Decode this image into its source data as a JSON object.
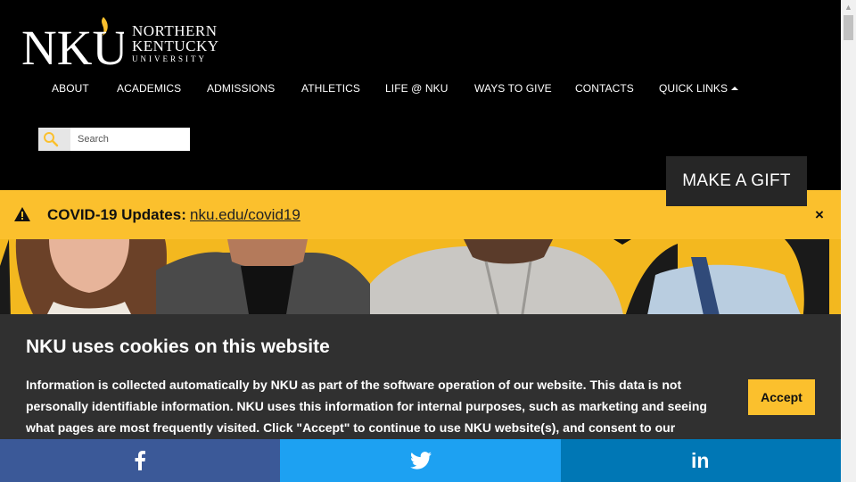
{
  "logo": {
    "mark": "NKU",
    "line1": "NORTHERN",
    "line2": "KENTUCKY",
    "line3": "UNIVERSITY",
    "flame_color": "#fbc02d"
  },
  "nav": {
    "items": [
      {
        "label": "ABOUT"
      },
      {
        "label": "ACADEMICS"
      },
      {
        "label": "ADMISSIONS"
      },
      {
        "label": "ATHLETICS"
      },
      {
        "label": "LIFE @ NKU"
      },
      {
        "label": "WAYS TO GIVE"
      },
      {
        "label": "CONTACTS"
      },
      {
        "label": "QUICK LINKS"
      }
    ]
  },
  "search": {
    "placeholder": "Search",
    "icon": "search-icon"
  },
  "gift_button": "MAKE A GIFT",
  "covid": {
    "label": "COVID-19 Updates:",
    "link": "nku.edu/covid19",
    "close": "×",
    "icon": "warning-icon"
  },
  "cookie": {
    "title": "NKU uses cookies on this website",
    "body": "Information is collected automatically by NKU as part of the software operation of our website. This data is not personally identifiable information. NKU uses this information for internal purposes, such as marketing and seeing what pages are most frequently visited. Click \"Accept\" to continue to use NKU website(s), and consent to our",
    "accept": "Accept"
  },
  "share": {
    "facebook": {
      "icon": "facebook-icon",
      "color": "#3b5998"
    },
    "twitter": {
      "icon": "twitter-icon",
      "color": "#1da1f2"
    },
    "linkedin": {
      "icon": "linkedin-icon",
      "label": "in",
      "color": "#0077b5"
    }
  },
  "colors": {
    "brand_gold": "#fbc02d",
    "header_bg": "#000000",
    "cookie_bg": "#303030"
  }
}
